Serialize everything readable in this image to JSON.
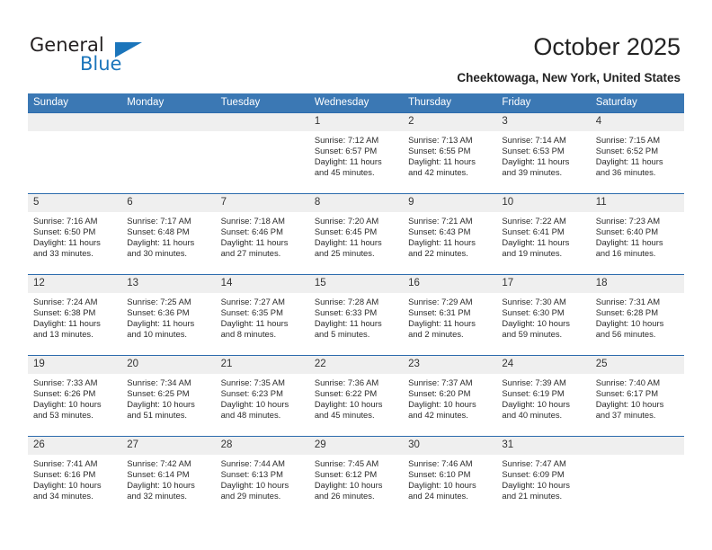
{
  "brand": {
    "name_part1": "General",
    "name_part2": "Blue",
    "accent_color": "#1b75bb",
    "triangle_icon": "triangle-icon"
  },
  "header": {
    "title": "October 2025",
    "subtitle": "Cheektowaga, New York, United States"
  },
  "calendar": {
    "header_bg": "#3b78b4",
    "row_divider_color": "#2c6bad",
    "daynum_bg": "#efefef",
    "weekday_headers": [
      "Sunday",
      "Monday",
      "Tuesday",
      "Wednesday",
      "Thursday",
      "Friday",
      "Saturday"
    ],
    "weeks": [
      [
        {
          "day": "",
          "sunrise": "",
          "sunset": "",
          "daylight_line1": "",
          "daylight_line2": ""
        },
        {
          "day": "",
          "sunrise": "",
          "sunset": "",
          "daylight_line1": "",
          "daylight_line2": ""
        },
        {
          "day": "",
          "sunrise": "",
          "sunset": "",
          "daylight_line1": "",
          "daylight_line2": ""
        },
        {
          "day": "1",
          "sunrise": "Sunrise: 7:12 AM",
          "sunset": "Sunset: 6:57 PM",
          "daylight_line1": "Daylight: 11 hours",
          "daylight_line2": "and 45 minutes."
        },
        {
          "day": "2",
          "sunrise": "Sunrise: 7:13 AM",
          "sunset": "Sunset: 6:55 PM",
          "daylight_line1": "Daylight: 11 hours",
          "daylight_line2": "and 42 minutes."
        },
        {
          "day": "3",
          "sunrise": "Sunrise: 7:14 AM",
          "sunset": "Sunset: 6:53 PM",
          "daylight_line1": "Daylight: 11 hours",
          "daylight_line2": "and 39 minutes."
        },
        {
          "day": "4",
          "sunrise": "Sunrise: 7:15 AM",
          "sunset": "Sunset: 6:52 PM",
          "daylight_line1": "Daylight: 11 hours",
          "daylight_line2": "and 36 minutes."
        }
      ],
      [
        {
          "day": "5",
          "sunrise": "Sunrise: 7:16 AM",
          "sunset": "Sunset: 6:50 PM",
          "daylight_line1": "Daylight: 11 hours",
          "daylight_line2": "and 33 minutes."
        },
        {
          "day": "6",
          "sunrise": "Sunrise: 7:17 AM",
          "sunset": "Sunset: 6:48 PM",
          "daylight_line1": "Daylight: 11 hours",
          "daylight_line2": "and 30 minutes."
        },
        {
          "day": "7",
          "sunrise": "Sunrise: 7:18 AM",
          "sunset": "Sunset: 6:46 PM",
          "daylight_line1": "Daylight: 11 hours",
          "daylight_line2": "and 27 minutes."
        },
        {
          "day": "8",
          "sunrise": "Sunrise: 7:20 AM",
          "sunset": "Sunset: 6:45 PM",
          "daylight_line1": "Daylight: 11 hours",
          "daylight_line2": "and 25 minutes."
        },
        {
          "day": "9",
          "sunrise": "Sunrise: 7:21 AM",
          "sunset": "Sunset: 6:43 PM",
          "daylight_line1": "Daylight: 11 hours",
          "daylight_line2": "and 22 minutes."
        },
        {
          "day": "10",
          "sunrise": "Sunrise: 7:22 AM",
          "sunset": "Sunset: 6:41 PM",
          "daylight_line1": "Daylight: 11 hours",
          "daylight_line2": "and 19 minutes."
        },
        {
          "day": "11",
          "sunrise": "Sunrise: 7:23 AM",
          "sunset": "Sunset: 6:40 PM",
          "daylight_line1": "Daylight: 11 hours",
          "daylight_line2": "and 16 minutes."
        }
      ],
      [
        {
          "day": "12",
          "sunrise": "Sunrise: 7:24 AM",
          "sunset": "Sunset: 6:38 PM",
          "daylight_line1": "Daylight: 11 hours",
          "daylight_line2": "and 13 minutes."
        },
        {
          "day": "13",
          "sunrise": "Sunrise: 7:25 AM",
          "sunset": "Sunset: 6:36 PM",
          "daylight_line1": "Daylight: 11 hours",
          "daylight_line2": "and 10 minutes."
        },
        {
          "day": "14",
          "sunrise": "Sunrise: 7:27 AM",
          "sunset": "Sunset: 6:35 PM",
          "daylight_line1": "Daylight: 11 hours",
          "daylight_line2": "and 8 minutes."
        },
        {
          "day": "15",
          "sunrise": "Sunrise: 7:28 AM",
          "sunset": "Sunset: 6:33 PM",
          "daylight_line1": "Daylight: 11 hours",
          "daylight_line2": "and 5 minutes."
        },
        {
          "day": "16",
          "sunrise": "Sunrise: 7:29 AM",
          "sunset": "Sunset: 6:31 PM",
          "daylight_line1": "Daylight: 11 hours",
          "daylight_line2": "and 2 minutes."
        },
        {
          "day": "17",
          "sunrise": "Sunrise: 7:30 AM",
          "sunset": "Sunset: 6:30 PM",
          "daylight_line1": "Daylight: 10 hours",
          "daylight_line2": "and 59 minutes."
        },
        {
          "day": "18",
          "sunrise": "Sunrise: 7:31 AM",
          "sunset": "Sunset: 6:28 PM",
          "daylight_line1": "Daylight: 10 hours",
          "daylight_line2": "and 56 minutes."
        }
      ],
      [
        {
          "day": "19",
          "sunrise": "Sunrise: 7:33 AM",
          "sunset": "Sunset: 6:26 PM",
          "daylight_line1": "Daylight: 10 hours",
          "daylight_line2": "and 53 minutes."
        },
        {
          "day": "20",
          "sunrise": "Sunrise: 7:34 AM",
          "sunset": "Sunset: 6:25 PM",
          "daylight_line1": "Daylight: 10 hours",
          "daylight_line2": "and 51 minutes."
        },
        {
          "day": "21",
          "sunrise": "Sunrise: 7:35 AM",
          "sunset": "Sunset: 6:23 PM",
          "daylight_line1": "Daylight: 10 hours",
          "daylight_line2": "and 48 minutes."
        },
        {
          "day": "22",
          "sunrise": "Sunrise: 7:36 AM",
          "sunset": "Sunset: 6:22 PM",
          "daylight_line1": "Daylight: 10 hours",
          "daylight_line2": "and 45 minutes."
        },
        {
          "day": "23",
          "sunrise": "Sunrise: 7:37 AM",
          "sunset": "Sunset: 6:20 PM",
          "daylight_line1": "Daylight: 10 hours",
          "daylight_line2": "and 42 minutes."
        },
        {
          "day": "24",
          "sunrise": "Sunrise: 7:39 AM",
          "sunset": "Sunset: 6:19 PM",
          "daylight_line1": "Daylight: 10 hours",
          "daylight_line2": "and 40 minutes."
        },
        {
          "day": "25",
          "sunrise": "Sunrise: 7:40 AM",
          "sunset": "Sunset: 6:17 PM",
          "daylight_line1": "Daylight: 10 hours",
          "daylight_line2": "and 37 minutes."
        }
      ],
      [
        {
          "day": "26",
          "sunrise": "Sunrise: 7:41 AM",
          "sunset": "Sunset: 6:16 PM",
          "daylight_line1": "Daylight: 10 hours",
          "daylight_line2": "and 34 minutes."
        },
        {
          "day": "27",
          "sunrise": "Sunrise: 7:42 AM",
          "sunset": "Sunset: 6:14 PM",
          "daylight_line1": "Daylight: 10 hours",
          "daylight_line2": "and 32 minutes."
        },
        {
          "day": "28",
          "sunrise": "Sunrise: 7:44 AM",
          "sunset": "Sunset: 6:13 PM",
          "daylight_line1": "Daylight: 10 hours",
          "daylight_line2": "and 29 minutes."
        },
        {
          "day": "29",
          "sunrise": "Sunrise: 7:45 AM",
          "sunset": "Sunset: 6:12 PM",
          "daylight_line1": "Daylight: 10 hours",
          "daylight_line2": "and 26 minutes."
        },
        {
          "day": "30",
          "sunrise": "Sunrise: 7:46 AM",
          "sunset": "Sunset: 6:10 PM",
          "daylight_line1": "Daylight: 10 hours",
          "daylight_line2": "and 24 minutes."
        },
        {
          "day": "31",
          "sunrise": "Sunrise: 7:47 AM",
          "sunset": "Sunset: 6:09 PM",
          "daylight_line1": "Daylight: 10 hours",
          "daylight_line2": "and 21 minutes."
        },
        {
          "day": "",
          "sunrise": "",
          "sunset": "",
          "daylight_line1": "",
          "daylight_line2": ""
        }
      ]
    ]
  }
}
